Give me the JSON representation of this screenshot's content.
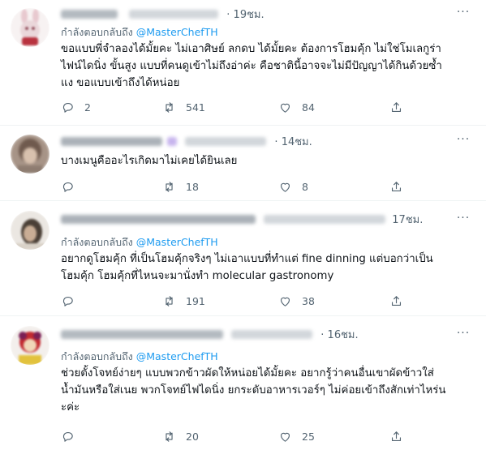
{
  "reply_prefix": "กำลังตอบกลับถึง",
  "tweets": [
    {
      "time": "19ชม.",
      "reply_to": "@MasterChefTH",
      "text": "ขอแบบพี่จำลองได้มั้ยคะ ไม่เอาศิษย์ ลกดบ ได้มั้ยคะ ต้องการโฮมคุ้ก ไม่ใช่โมเลกูร่า\nไฟน์ไดนิ่ง ขั้นสูง แบบที่คนดูเข้าไม่ถึงอ่าค่ะ คือชาตินี้อาจจะไม่มีปัญญาได้กินด้วยซ้ำ\nแง ขอแบบเข้าถึงได้หน่อย",
      "replies": "2",
      "retweets": "541",
      "likes": "84"
    },
    {
      "time": "14ชม.",
      "reply_to": "",
      "text": "บางเมนูคืออะไรเกิดมาไม่เคยได้ยินเลย",
      "replies": "",
      "retweets": "18",
      "likes": "8"
    },
    {
      "time": "17ชม.",
      "reply_to": "@MasterChefTH",
      "text": "อยากดูโฮมคุ้ก ที่เป็นโฮมคุ้กจริงๆ ไม่เอาแบบที่ทำแต่ fine dinning แต่บอกว่าเป็น\nโฮมคุ้ก โฮมคุ้กที่ไหนจะมานั่งทำ molecular gastronomy",
      "replies": "",
      "retweets": "191",
      "likes": "38"
    },
    {
      "time": "16ชม.",
      "reply_to": "@MasterChefTH",
      "text": "ช่วยตั้งโจทย์ง่ายๆ แบบพวกข้าวผัดให้หน่อยได้มั้ยคะ อยากรู้ว่าคนอื่นเขาผัดข้าวใส่\nน้ำมันหรือใส่เนย พวกโจทย์ไฟไดนิ่ง ยกระดับอาหารเวอร์ๆ ไม่ค่อยเข้าถึงสักเท่าไหร่น\nะค่ะ",
      "replies": "",
      "retweets": "20",
      "likes": "25"
    }
  ],
  "icons": {
    "reply": "reply-icon",
    "retweet": "retweet-icon",
    "like": "heart-icon",
    "share": "share-icon",
    "more": "more-icon"
  },
  "colors": {
    "link": "#1d9bf0",
    "secondary": "#536471",
    "text": "#0f1419",
    "divider": "#eff3f4"
  }
}
